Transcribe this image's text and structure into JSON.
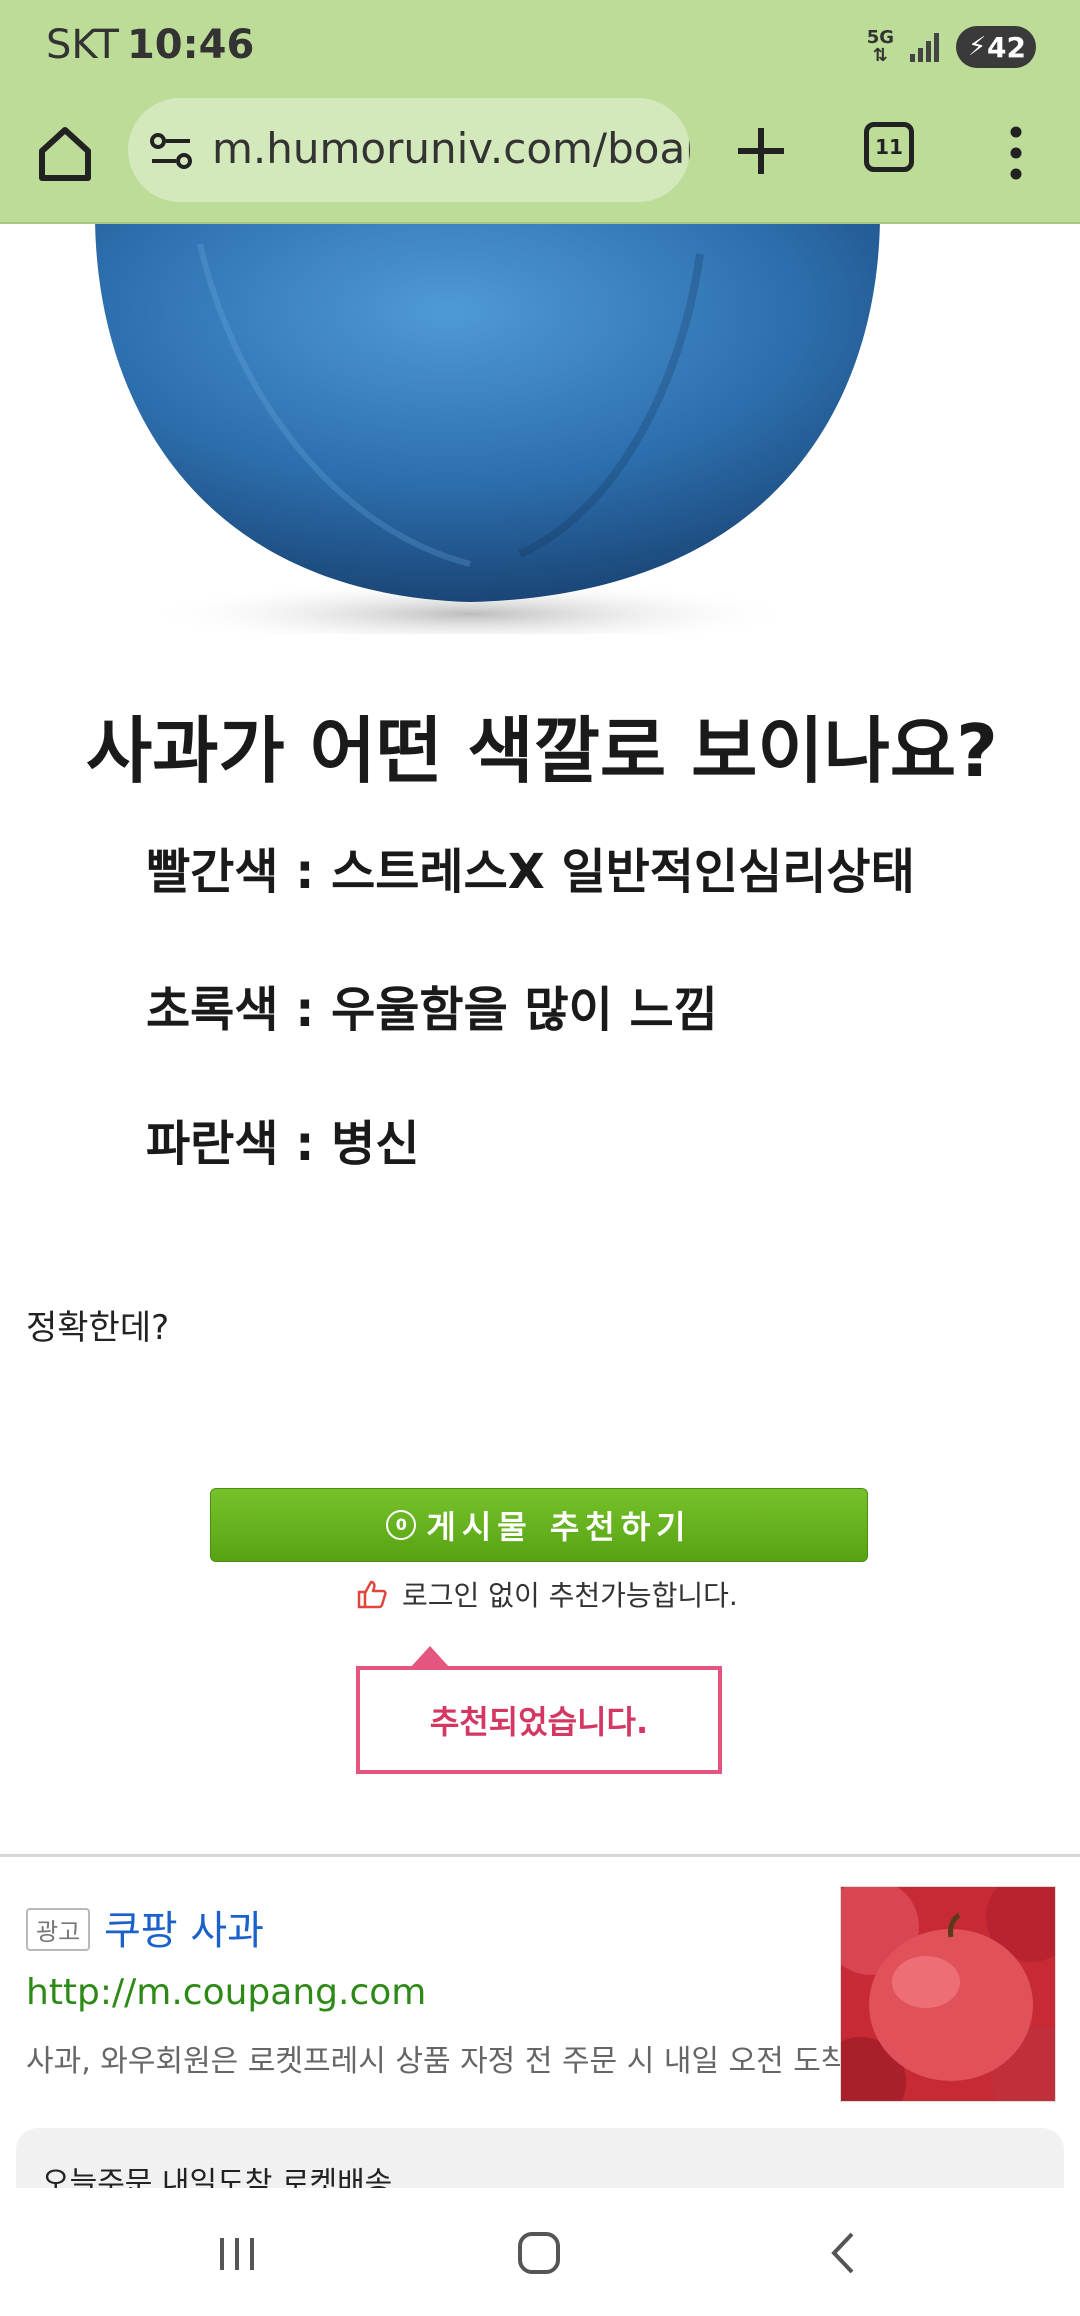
{
  "status_bar": {
    "carrier": "SKT",
    "time": "10:46",
    "network": "5G",
    "battery": "42"
  },
  "browser": {
    "url": "m.humoruniv.com/board",
    "tab_count": "11"
  },
  "post": {
    "question": "사과가 어떤 색깔로 보이나요?",
    "answers": [
      "빨간색 : 스트레스X 일반적인심리상태",
      "초록색 : 우울함을 많이 느낌",
      "파란색 : 병신"
    ],
    "comment": "정확한데?",
    "recommend_count": "0",
    "recommend_label": "게시물 추천하기",
    "login_note": "로그인 없이 추천가능합니다.",
    "recommended_message": "추천되었습니다."
  },
  "ad": {
    "badge": "광고",
    "title": "쿠팡 사과",
    "url": "http://m.coupang.com",
    "description": "사과, 와우회원은 로켓프레시 상품 자정 전 주문 시 내일 오전 도착!",
    "card_text": "오늘주문 내일도착 로켓배송"
  },
  "colors": {
    "browser_bar": "#bddc98",
    "recommend_button": "#5fae1b",
    "popup_accent": "#e4557f",
    "ad_link": "#1a61c9",
    "ad_url": "#2d8a16"
  }
}
